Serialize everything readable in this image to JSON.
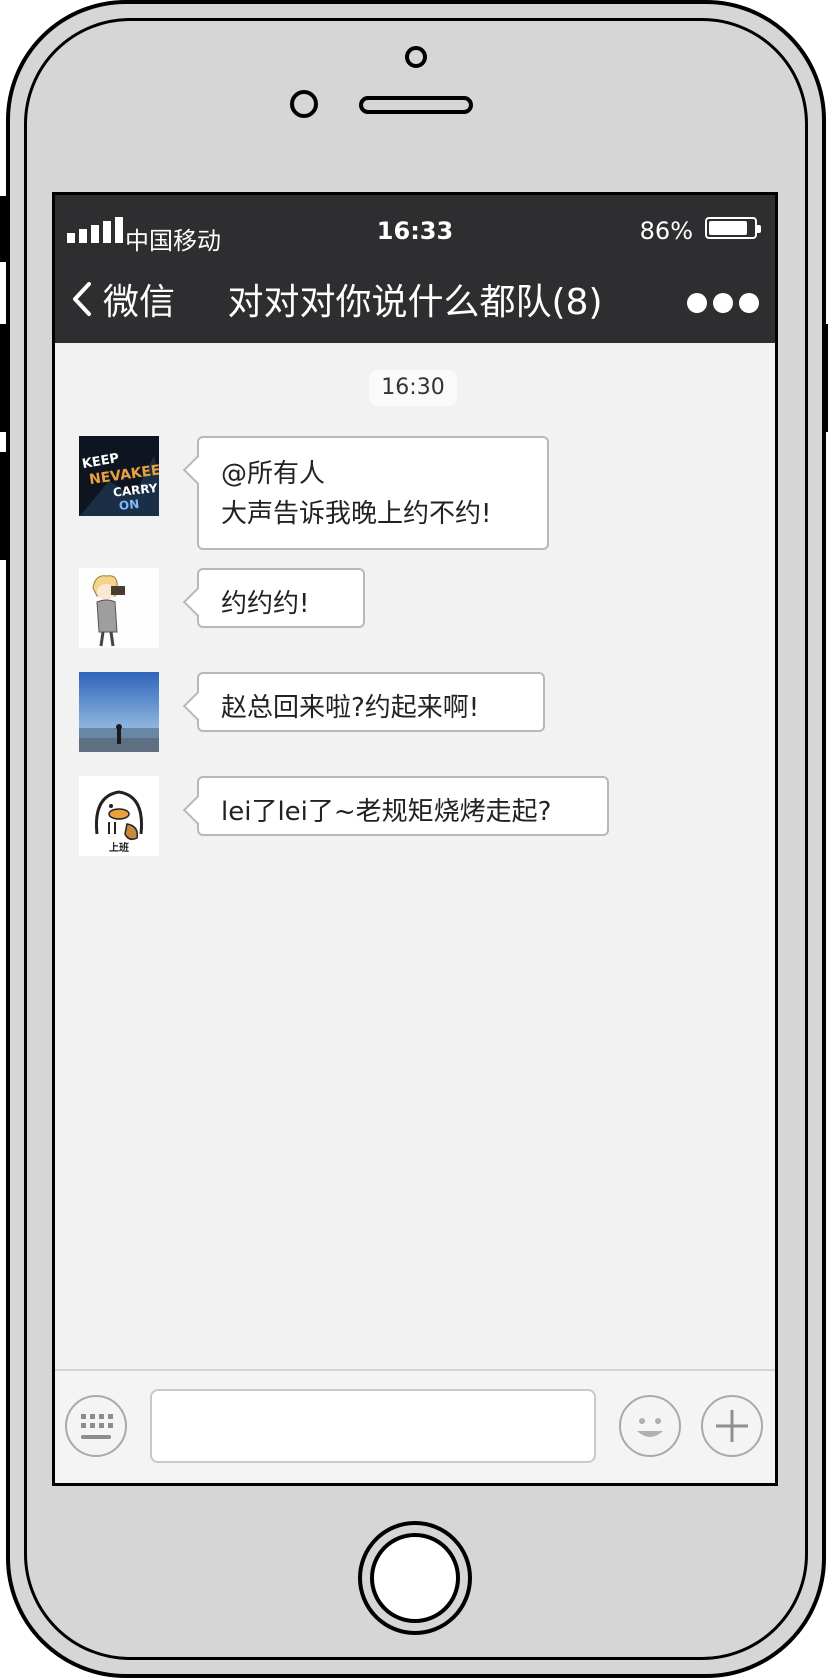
{
  "status_bar": {
    "carrier": "中国移动",
    "time": "16:33",
    "battery_percent": "86%",
    "battery_level": 0.86
  },
  "nav": {
    "back_label": "微信",
    "title": "对对对你说什么都队(8)",
    "more_icon": "more-dots-icon"
  },
  "chat": {
    "timestamp": "16:30",
    "messages": [
      {
        "line1": "@所有人",
        "line2": "大声告诉我晚上约不约!"
      },
      {
        "text": "约约约!"
      },
      {
        "text": "赵总回来啦?约起来啊!"
      },
      {
        "text": "lei了lei了~老规矩烧烤走起?"
      }
    ],
    "avatars": [
      {
        "icon": "avatar-keep-carry-on",
        "text": [
          "KEEP",
          "NEVAKEE",
          "CARRY",
          "ON"
        ]
      },
      {
        "icon": "avatar-anime-boy"
      },
      {
        "icon": "avatar-beach-photo"
      },
      {
        "icon": "avatar-duck-sticker",
        "text": "上班"
      }
    ]
  },
  "input_bar": {
    "keyboard_icon": "keyboard-icon",
    "text_value": "",
    "emoji_icon": "emoji-icon",
    "add_icon": "plus-icon"
  },
  "colors": {
    "header_bg": "#2e2e31",
    "chat_bg": "#f2f2f2",
    "phone_body": "#d6d6d6"
  }
}
